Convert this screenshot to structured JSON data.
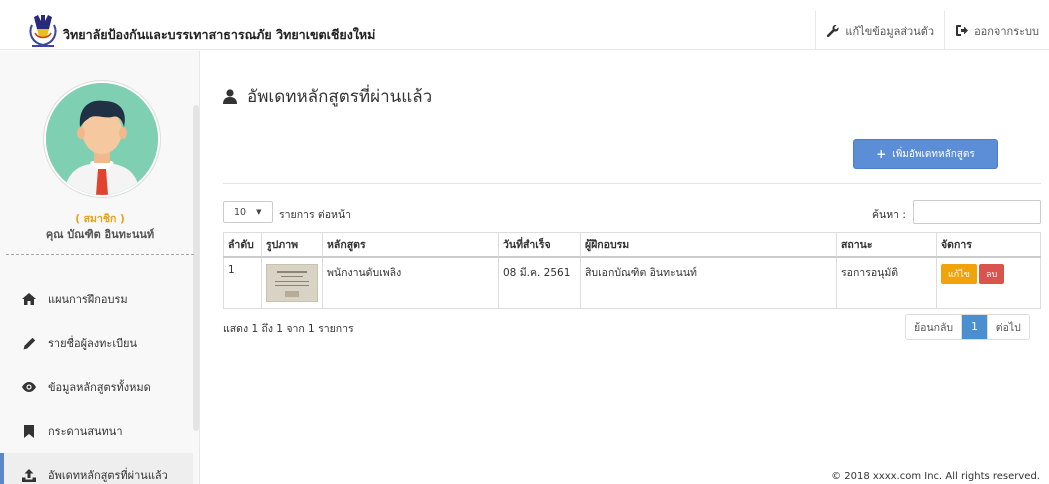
{
  "header": {
    "brand_title": "วิทยาลัยป้องกันและบรรเทาสาธารณภัย วิทยาเขตเชียงใหม่",
    "edit_profile_label": "แก้ไขข้อมูลส่วนตัว",
    "logout_label": "ออกจากระบบ"
  },
  "sidebar": {
    "member_label": "( สมาชิก )",
    "member_name": "คุณ บัณฑิต อินทะนนท์",
    "items": [
      {
        "label": "แผนการฝึกอบรม",
        "icon": "home-icon"
      },
      {
        "label": "รายชื่อผู้ลงทะเบียน",
        "icon": "pencil-icon"
      },
      {
        "label": "ข้อมูลหลักสูตรทั้งหมด",
        "icon": "eye-icon"
      },
      {
        "label": "กระดานสนทนา",
        "icon": "bookmark-icon"
      },
      {
        "label": "อัพเดทหลักสูตรที่ผ่านแล้ว",
        "icon": "upload-icon",
        "active": true
      }
    ]
  },
  "main": {
    "page_title": "อัพเดทหลักสูตรที่ผ่านแล้ว",
    "add_button_label": "เพิ่มอัพเดทหลักสูตร",
    "length_value": "10",
    "length_label": "รายการ ต่อหน้า",
    "search_label": "ค้นหา :",
    "search_value": "",
    "table": {
      "headers": [
        "ลำดับ",
        "รูปภาพ",
        "หลักสูตร",
        "วันที่สำเร็จ",
        "ผู้ฝึกอบรม",
        "สถานะ",
        "จัดการ"
      ],
      "rows": [
        {
          "no": "1",
          "course": "พนักงานดับเพลิง",
          "date": "08 มี.ค. 2561",
          "trainer": "สิบเอกบัณฑิต อินทะนนท์",
          "status": "รอการอนุมัติ",
          "edit_label": "แก้ไข",
          "delete_label": "ลบ"
        }
      ]
    },
    "info_text": "แสดง 1 ถึง 1 จาก 1 รายการ",
    "pagination": {
      "prev": "ย้อนกลับ",
      "current": "1",
      "next": "ต่อไป"
    }
  },
  "footer": {
    "copyright": "© 2018 xxxx.com Inc. All rights reserved."
  },
  "colors": {
    "accent_blue": "#5b8ed6",
    "member_orange": "#e8a215",
    "edit_orange": "#f0a30a",
    "delete_red": "#d9534f",
    "active_border": "#5b88c6",
    "avatar_bg": "#7fd0b2"
  }
}
